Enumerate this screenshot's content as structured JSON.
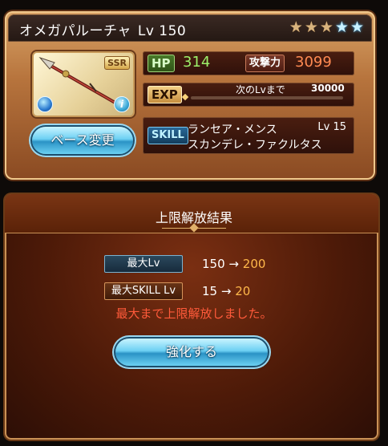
{
  "weapon": {
    "name": "オメガパルーチャ",
    "level": "Lv 150",
    "rarity": "SSR",
    "stars": [
      "bronze",
      "bronze",
      "bronze",
      "blue",
      "blue"
    ]
  },
  "buttons": {
    "base_change": "ベース変更",
    "strengthen": "強化する"
  },
  "stats": {
    "hp_label": "HP",
    "hp_value": "314",
    "atk_label": "攻撃力",
    "atk_value": "3099",
    "exp_label": "EXP",
    "next_level_label": "次のLvまで",
    "next_level_exp": "30000",
    "exp_progress": 0
  },
  "skill": {
    "tag": "SKILL",
    "name_line1": "ランセア・メンス",
    "level": "Lv 15",
    "name_line2": "スカンデレ・ファクルタス"
  },
  "result": {
    "title": "上限解放結果",
    "max_lv_label": "最大Lv",
    "max_lv_old": "150",
    "max_lv_new": "200",
    "max_skill_label": "最大SKILL Lv",
    "max_skill_old": "15",
    "max_skill_new": "20",
    "arrow": "→",
    "message": "最大まで上限解放しました。"
  },
  "colors": {
    "hp_value": "#9df06a",
    "atk_value": "#ff8a52",
    "new_value": "#ffb84a",
    "message": "#ff5a3a"
  }
}
